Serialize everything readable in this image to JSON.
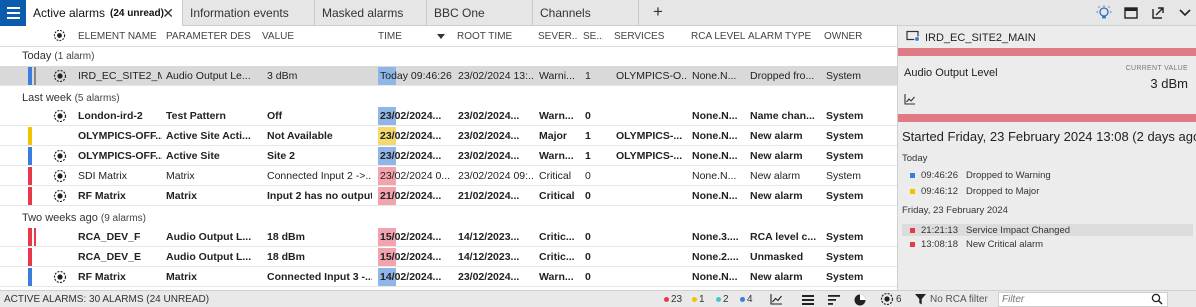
{
  "tabs": [
    {
      "label": "Active alarms",
      "unread": "(24 unread)"
    },
    {
      "label": "Information events"
    },
    {
      "label": "Masked alarms"
    },
    {
      "label": "BBC One"
    },
    {
      "label": "Channels"
    }
  ],
  "columns": {
    "element_name": "ELEMENT NAME",
    "parameter": "PARAMETER DES...",
    "value": "VALUE",
    "time": "TIME",
    "root_time": "ROOT TIME",
    "severity": "SEVER...",
    "se": "SE...",
    "services": "SERVICES",
    "rca_level": "RCA LEVEL",
    "alarm_type": "ALARM TYPE",
    "owner": "OWNER"
  },
  "groups": [
    {
      "label": "Today",
      "count": "(1 alarm)"
    },
    {
      "label": "Last week",
      "count": "(5 alarms)"
    },
    {
      "label": "Two weeks ago",
      "count": "(9 alarms)"
    }
  ],
  "rows": [
    {
      "element": "IRD_EC_SITE2_M...",
      "parameter": "Audio Output Le...",
      "value": "3 dBm",
      "time": "Today 09:46:26",
      "root_time": "23/02/2024 13:...",
      "severity": "Warni...",
      "se": "1",
      "services": "OLYMPICS-O...",
      "rca": "None.N...",
      "alarm_type": "Dropped fro...",
      "owner": "System"
    },
    {
      "element": "London-ird-2",
      "parameter": "Test Pattern",
      "value": "Off",
      "time": "23/02/2024...",
      "root_time": "23/02/2024...",
      "severity": "Warn...",
      "se": "0",
      "services": "",
      "rca": "None.N...",
      "alarm_type": "Name chan...",
      "owner": "System"
    },
    {
      "element": "OLYMPICS-OFF...",
      "parameter": "Active Site Acti...",
      "value": "Not Available",
      "time": "23/02/2024...",
      "root_time": "23/02/2024...",
      "severity": "Major",
      "se": "1",
      "services": "OLYMPICS-...",
      "rca": "None.N...",
      "alarm_type": "New alarm",
      "owner": "System"
    },
    {
      "element": "OLYMPICS-OFF...",
      "parameter": "Active Site",
      "value": "Site 2",
      "time": "23/02/2024...",
      "root_time": "23/02/2024...",
      "severity": "Warn...",
      "se": "1",
      "services": "OLYMPICS-...",
      "rca": "None.N...",
      "alarm_type": "New alarm",
      "owner": "System"
    },
    {
      "element": "SDI Matrix",
      "parameter": "Matrix",
      "value": "Connected Input 2 ->...",
      "time": "23/02/2024 0...",
      "root_time": "23/02/2024 09:...",
      "severity": "Critical",
      "se": "0",
      "services": "",
      "rca": "None.N...",
      "alarm_type": "New alarm",
      "owner": "System"
    },
    {
      "element": "RF Matrix",
      "parameter": "Matrix",
      "value": "Input 2 has no output",
      "time": "21/02/2024...",
      "root_time": "21/02/2024...",
      "severity": "Critical",
      "se": "0",
      "services": "",
      "rca": "None.N...",
      "alarm_type": "New alarm",
      "owner": "System"
    },
    {
      "element": "RCA_DEV_F",
      "parameter": "Audio Output L...",
      "value": "18 dBm",
      "time": "15/02/2024...",
      "root_time": "14/12/2023...",
      "severity": "Critic...",
      "se": "0",
      "services": "",
      "rca": "None.3....",
      "alarm_type": "RCA level c...",
      "owner": "System"
    },
    {
      "element": "RCA_DEV_E",
      "parameter": "Audio Output L...",
      "value": "18 dBm",
      "time": "15/02/2024...",
      "root_time": "14/12/2023...",
      "severity": "Critic...",
      "se": "0",
      "services": "",
      "rca": "None.2....",
      "alarm_type": "Unmasked",
      "owner": "System"
    },
    {
      "element": "RF Matrix",
      "parameter": "Matrix",
      "value": "Connected Input 3 -...",
      "time": "14/02/2024...",
      "root_time": "23/02/2024...",
      "severity": "Warn...",
      "se": "0",
      "services": "",
      "rca": "None.N...",
      "alarm_type": "New alarm",
      "owner": "System"
    }
  ],
  "detail": {
    "title": "IRD_EC_SITE2_MAIN",
    "parameter": "Audio Output Level",
    "current_value_label": "CURRENT VALUE",
    "current_value": "3 dBm",
    "started": "Started Friday, 23 February 2024 13:08 (2 days ago)",
    "day1": "Today",
    "events_today": [
      {
        "time": "09:46:26",
        "text": "Dropped to Warning"
      },
      {
        "time": "09:46:12",
        "text": "Dropped to Major"
      }
    ],
    "day2": "Friday, 23 February 2024",
    "events_day2": [
      {
        "time": "21:21:13",
        "text": "Service Impact Changed"
      },
      {
        "time": "13:08:18",
        "text": "New Critical alarm"
      }
    ]
  },
  "status": {
    "summary": "ACTIVE ALARMS: 30 ALARMS (24 UNREAD)",
    "critical": "23",
    "major": "1",
    "minor": "2",
    "warning": "4",
    "masked_count": "6",
    "rca_filter": "No RCA filter",
    "filter_placeholder": "Filter"
  },
  "colors": {
    "critical": "#e8384b",
    "major": "#f2c400",
    "minor": "#49c2d6",
    "warning": "#3b7ddd",
    "accent": "#0b5cad",
    "detail_band": "#e07a86"
  }
}
